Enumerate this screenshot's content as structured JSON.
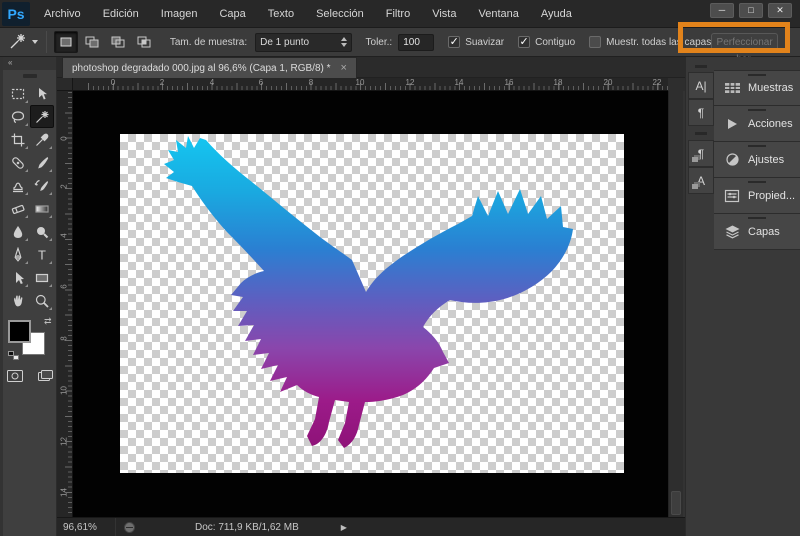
{
  "app": {
    "logo": "Ps",
    "logo_color": "#31a8ff"
  },
  "menubar": {
    "items": [
      "Archivo",
      "Edición",
      "Imagen",
      "Capa",
      "Texto",
      "Selección",
      "Filtro",
      "Vista",
      "Ventana",
      "Ayuda"
    ]
  },
  "window_controls": {
    "minimize": "─",
    "maximize": "□",
    "close": "✕"
  },
  "options_bar": {
    "tool_icon": "magic-wand-icon",
    "sample_size_label": "Tam. de muestra:",
    "sample_size_value": "De 1 punto",
    "tolerance_label": "Toler.:",
    "tolerance_value": "100",
    "check_glyph": "✓",
    "checkboxes": [
      {
        "label": "Suavizar",
        "checked": true
      },
      {
        "label": "Contiguo",
        "checked": true
      },
      {
        "label": "Muestr. todas las capas",
        "checked": false
      }
    ],
    "refine_edge_label": "Perfeccionar bor.",
    "refine_edge_enabled": false,
    "highlight_box_color": "#e2831b"
  },
  "tabbar": {
    "tab_title": "photoshop degradado 000.jpg al 96,6% (Capa 1, RGB/8) *",
    "close_glyph": "×"
  },
  "toolbar": {
    "collapse_glyph": "«",
    "tools": [
      "rectangular-marquee",
      "move",
      "lasso",
      "magic-wand",
      "crop",
      "eyedropper",
      "healing-brush",
      "brush",
      "clone-stamp",
      "history-brush",
      "eraser",
      "gradient",
      "blur",
      "dodge",
      "pen",
      "type",
      "path-selection",
      "rectangle-shape",
      "hand",
      "zoom"
    ],
    "selected_tool": "magic-wand",
    "foreground_color": "#000000",
    "background_color": "#ffffff"
  },
  "rulers": {
    "h_labels": [
      "0",
      "2",
      "4",
      "6",
      "8",
      "10",
      "12",
      "14",
      "16",
      "18",
      "20",
      "22"
    ],
    "v_labels": [
      "2",
      "0",
      "2",
      "4",
      "6",
      "8",
      "10",
      "12",
      "14"
    ]
  },
  "statusbar": {
    "zoom": "96,61%",
    "doc_info": "Doc: 711,9 KB/1,62 MB",
    "menu_arrow": "▶"
  },
  "right_dock": {
    "narrow_panels": [
      {
        "icon": "character-panel-icon",
        "glyph": "A|"
      },
      {
        "icon": "paragraph-panel-icon",
        "glyph": "¶"
      },
      {
        "icon": "paragraph-styles-panel-icon",
        "glyph": "¶"
      },
      {
        "icon": "character-styles-panel-icon",
        "glyph": "A"
      }
    ],
    "panels": [
      {
        "label": "Muestras",
        "icon": "swatches-icon"
      },
      {
        "label": "Acciones",
        "icon": "actions-icon"
      },
      {
        "label": "Ajustes",
        "icon": "adjustments-icon"
      },
      {
        "label": "Propied...",
        "icon": "properties-icon"
      },
      {
        "label": "Capas",
        "icon": "layers-icon"
      }
    ]
  },
  "canvas": {
    "artwork": "eagle-silhouette",
    "transparency_checker_colors": [
      "#ffffff",
      "#cdcdcd"
    ],
    "gradient_colors": [
      "#14c6f0",
      "#2a80d2",
      "#5c60c1",
      "#8a46ac",
      "#9c1b89",
      "#8e1278"
    ]
  }
}
